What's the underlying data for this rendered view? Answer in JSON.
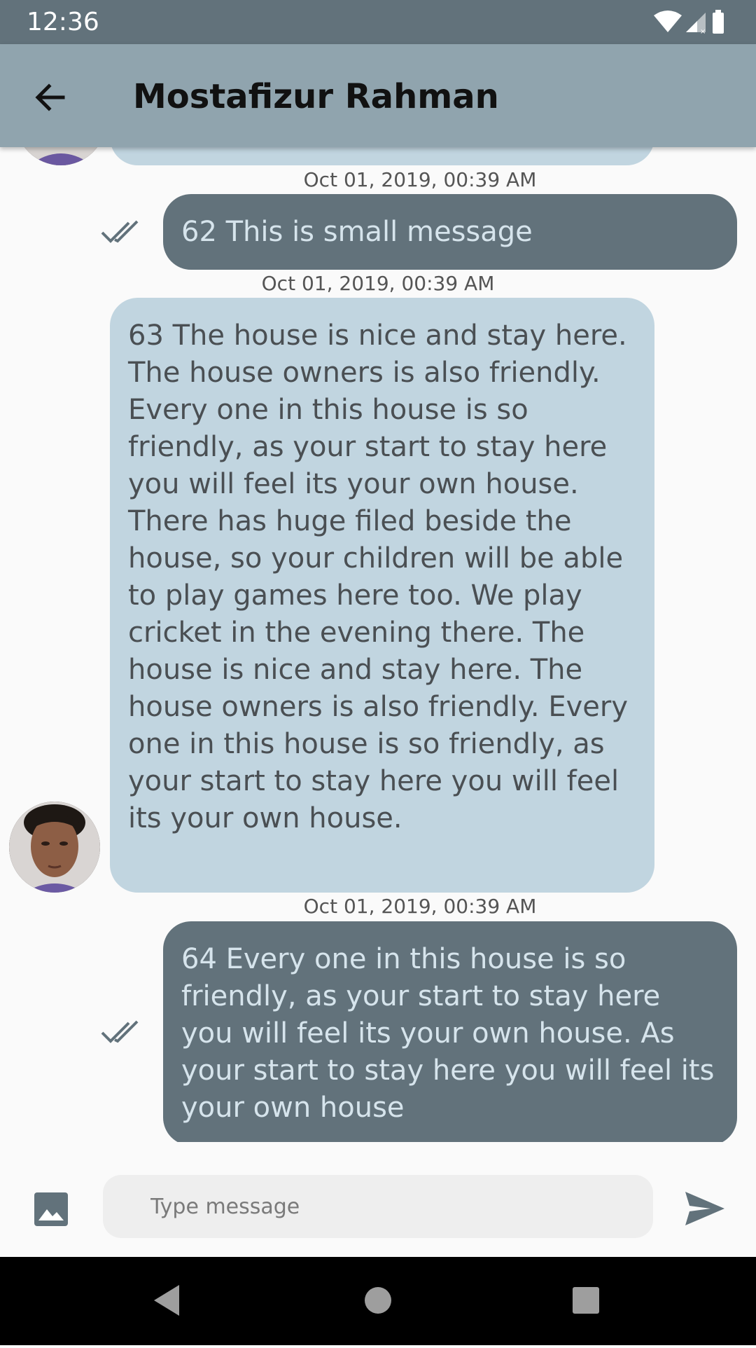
{
  "status_bar": {
    "time": "12:36",
    "icons": [
      "wifi-icon",
      "signal-icon",
      "battery-icon"
    ]
  },
  "app_bar": {
    "back_icon": "arrow-back-icon",
    "title": "Mostafizur Rahman"
  },
  "messages": [
    {
      "id": "prev-incoming",
      "direction": "incoming",
      "text": "",
      "partially_visible": true
    },
    {
      "id": "msg-62",
      "direction": "outgoing",
      "timestamp": "Oct 01, 2019, 00:39 AM",
      "text": "62 This is small message",
      "status_icon": "double-check-icon"
    },
    {
      "id": "msg-63",
      "direction": "incoming",
      "timestamp": "Oct 01, 2019, 00:39 AM",
      "text": "63 The house is nice and stay here. The house owners is also friendly. Every one in this house is so friendly, as your start to stay here you will feel its your own house. There has huge filed beside the house, so your children will be able to play games here too. We play cricket in the evening there. The house is nice and stay here. The house owners is also friendly. Every one in this house is so friendly, as your start to stay here you will feel its your own house."
    },
    {
      "id": "msg-64",
      "direction": "outgoing",
      "timestamp": "Oct 01, 2019, 00:39 AM",
      "text": "64 Every one in this house is so friendly, as your start to stay here you will feel its your own house. As your start to stay here you will feel its your own house",
      "status_icon": "double-check-icon"
    }
  ],
  "composer": {
    "image_icon": "image-icon",
    "placeholder": "Type message",
    "value": "",
    "send_icon": "send-icon"
  },
  "nav_bar": {
    "icons": [
      "back-triangle-icon",
      "home-circle-icon",
      "recents-square-icon"
    ]
  },
  "colors": {
    "status_bar": "#62727b",
    "app_bar": "#90a4ae",
    "incoming_bubble": "#c1d5e0",
    "outgoing_bubble": "#62727b",
    "background": "#fafafa"
  }
}
